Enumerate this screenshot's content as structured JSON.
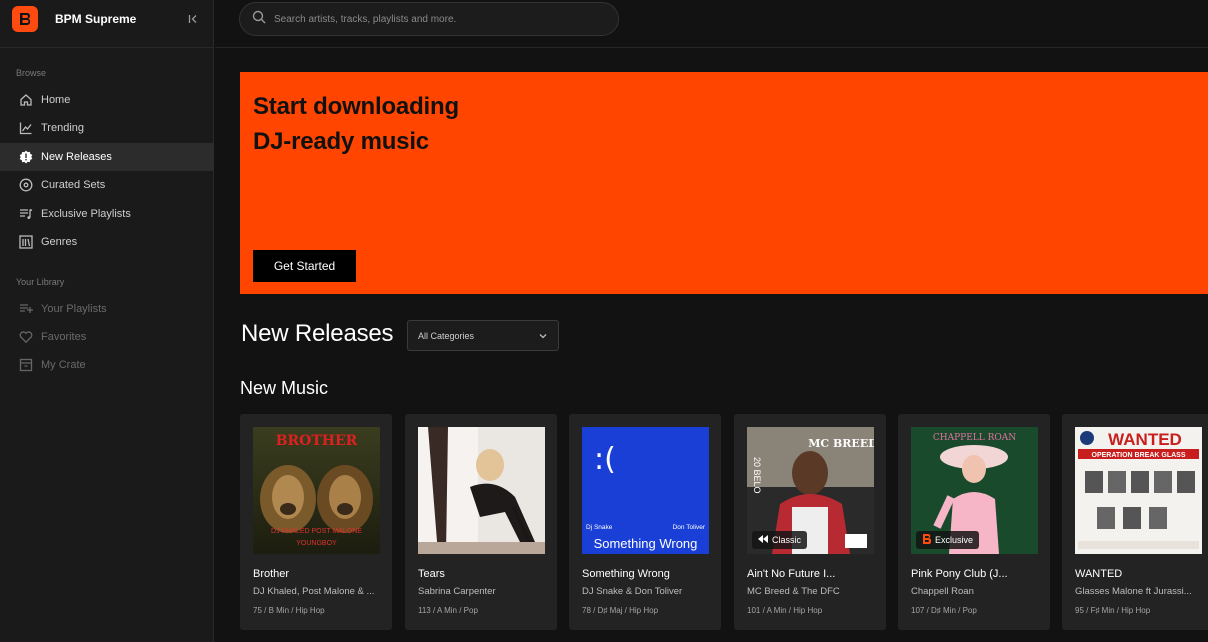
{
  "app": {
    "name": "BPM Supreme"
  },
  "search": {
    "placeholder": "Search artists, tracks, playlists and more."
  },
  "sidebar": {
    "browse_label": "Browse",
    "browse_items": [
      {
        "label": "Home",
        "icon": "home-icon"
      },
      {
        "label": "Trending",
        "icon": "trending-icon"
      },
      {
        "label": "New Releases",
        "icon": "new-badge-icon",
        "active": true
      },
      {
        "label": "Curated Sets",
        "icon": "disc-icon"
      },
      {
        "label": "Exclusive Playlists",
        "icon": "playlist-icon"
      },
      {
        "label": "Genres",
        "icon": "genres-icon"
      }
    ],
    "library_label": "Your Library",
    "library_items": [
      {
        "label": "Your Playlists",
        "icon": "playlist-add-icon"
      },
      {
        "label": "Favorites",
        "icon": "heart-icon"
      },
      {
        "label": "My Crate",
        "icon": "crate-icon"
      }
    ]
  },
  "hero": {
    "line1": "Start downloading",
    "line2": "DJ-ready music",
    "button": "Get Started",
    "color": "#ff4500"
  },
  "main": {
    "title": "New Releases",
    "category_select": "All Categories",
    "section_title": "New Music"
  },
  "cards": [
    {
      "title": "Brother",
      "artist": "DJ Khaled, Post Malone & ...",
      "meta": "75 / B Min / Hip Hop",
      "art_text": "BROTHER",
      "art_sub": "DJ KHALED   POST MALONE",
      "art_sub2": "YOUNGBOY"
    },
    {
      "title": "Tears",
      "artist": "Sabrina Carpenter",
      "meta": "113 / A Min / Pop"
    },
    {
      "title": "Something Wrong",
      "artist": "DJ Snake & Don Toliver",
      "meta": "78 / D♯ Maj / Hip Hop",
      "art_text": ":(",
      "art_left": "Dj Snake",
      "art_right": "Don Toliver",
      "art_title": "Something Wrong"
    },
    {
      "title": "Ain't No Future I...",
      "artist": "MC Breed & The DFC",
      "meta": "101 / A Min / Hip Hop",
      "art_text": "MC BREED",
      "art_side": "20 BELO",
      "badge": "Classic"
    },
    {
      "title": "Pink Pony Club (J...",
      "artist": "Chappell Roan",
      "meta": "107 / D♯ Min / Pop",
      "art_text": "CHAPPELL ROAN",
      "badge": "Exclusive"
    },
    {
      "title": "WANTED",
      "artist": "Glasses Malone ft Jurassi...",
      "meta": "95 / F♯ Min / Hip Hop",
      "art_text": "WANTED",
      "art_sub": "OPERATION BREAK GLASS"
    }
  ]
}
